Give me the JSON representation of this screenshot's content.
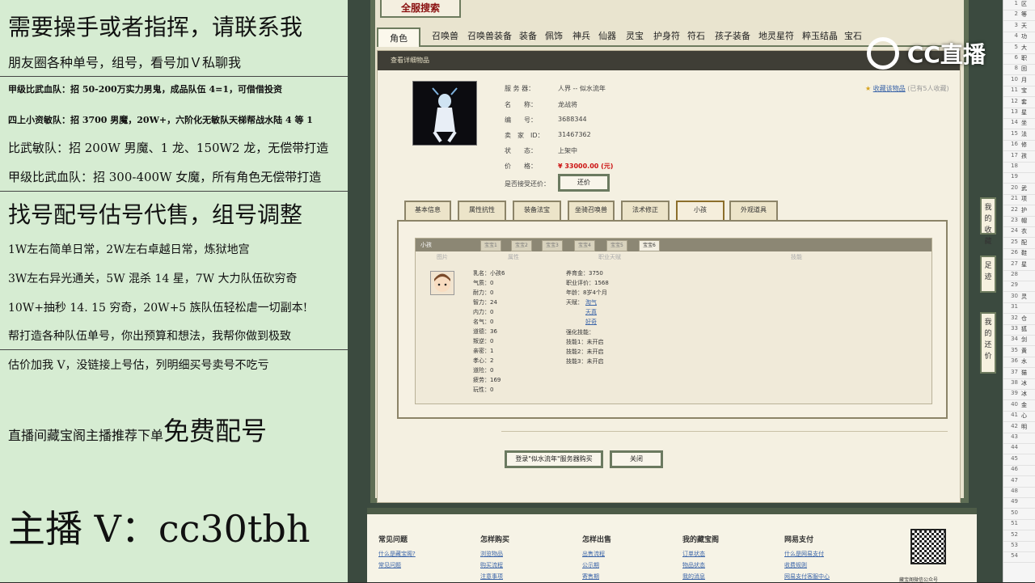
{
  "overlay": {
    "line1": "需要操手或者指挥，请联系我",
    "line2": "朋友圈各种单号，组号，看号加Ｖ私聊我",
    "line3": "甲级比武血队：招 50-200万实力男鬼，成品队伍 4=1，可借借投资",
    "line4": "四上小资敏队：招 3700 男魔，20W+，六阶化无敏队天梯帮战水陆 4 等 1",
    "line5": "比武敏队：招 200W 男魔、1 龙、150W2 龙，无偿带打造",
    "line6": "甲级比武血队：招 300-400W 女魔，所有角色无偿带打造",
    "line7": "找号配号估号代售，组号调整",
    "line8": "1W左右简单日常，2W左右卓越日常，炼狱地宫",
    "line9": "3W左右异光通关，5W 混杀 14 星，7W 大力队伍砍穷奇",
    "line10": "10W+抽秒 14. 15 穷奇，20W+5 族队伍轻松虐一切副本!",
    "line11": "帮打造各种队伍单号，你出预算和想法，我帮你做到极致",
    "line12": "估价加我 V，没链接上号估，列明细买号卖号不吃亏",
    "line13a": "直播间藏宝阁主播推荐下单",
    "line13b": "免费配号",
    "line14": "主播 V：cc30tbh"
  },
  "watermark": "CC直播",
  "search_tab": "全服搜索",
  "nav_tabs": [
    "角色",
    "召唤兽",
    "召唤兽装备",
    "装备",
    "佩饰",
    "神兵",
    "仙器",
    "灵宝",
    "护身符",
    "符石",
    "孩子装备",
    "地灵星符",
    "粹玉结晶",
    "宝石"
  ],
  "panel_title": "查看详细物品",
  "item": {
    "server_label": "服 务 器：",
    "server_value": "人界 -- 似水流年",
    "name_label": "名　　称：",
    "name_value": "龙战将",
    "id_label": "编　　号：",
    "id_value": "3688344",
    "seller_label": "卖　家　ID：",
    "seller_value": "31467362",
    "status_label": "状　　态：",
    "status_value": "上架中",
    "price_label": "价　　格：",
    "price_value": "¥ 33000.00 (元)",
    "bargain_label": "是否接受还价：",
    "bargain_button": "还价",
    "fav_link": "收藏该物品",
    "fav_count": "(已有5人收藏)"
  },
  "detail_tabs": [
    "基本信息",
    "属性抗性",
    "装备法宝",
    "坐骑召唤兽",
    "法术修正",
    "小孩",
    "外观道具"
  ],
  "child": {
    "header": "小孩",
    "babies": [
      "宝宝1",
      "宝宝2",
      "宝宝3",
      "宝宝4",
      "宝宝5",
      "宝宝6"
    ],
    "col_image": "图片",
    "col_attr": "属性",
    "col_career": "职业天赋",
    "col_skill": "技能",
    "stats": [
      "乳名：小孩6",
      "气质：0",
      "耐力：0",
      "智力：24",
      "内力：0",
      "名气：0",
      "道德：36",
      "叛逆：0",
      "亲密：1",
      "孝心：2",
      "道险：0",
      "疲劳：169",
      "玩性：0"
    ],
    "career": [
      "养育金：3750",
      "职业评价：1568",
      "年龄：8岁4个月",
      "天赋："
    ],
    "talents": [
      "淘气",
      "天真",
      "好奇"
    ],
    "skills_label": "强化技能：",
    "skills": [
      "技能1：未开启",
      "技能2：未开启",
      "技能3：未开启"
    ]
  },
  "buy_button": "登录\"似水流年\"服务器购买",
  "close_button": "关闭",
  "side_buttons": [
    "我的收藏",
    "足迹",
    "我的还价"
  ],
  "footer": {
    "cols": [
      {
        "title": "常见问题",
        "links": [
          "什么是藏宝阁?",
          "常见问题"
        ]
      },
      {
        "title": "怎样购买",
        "links": [
          "浏览物品",
          "购买流程",
          "注意事项"
        ]
      },
      {
        "title": "怎样出售",
        "links": [
          "出售流程",
          "公示期",
          "寄售期"
        ]
      },
      {
        "title": "我的藏宝阁",
        "links": [
          "订单状态",
          "物品状态",
          "我的消息"
        ]
      },
      {
        "title": "网易支付",
        "links": [
          "什么是网易支付",
          "收费规则",
          "网易支付客服中心"
        ]
      }
    ],
    "qr_caption": "藏宝阁微信公众号"
  },
  "sheet_rows": [
    {
      "n": "1",
      "t": "区"
    },
    {
      "n": "2",
      "t": "等"
    },
    {
      "n": "3",
      "t": "天"
    },
    {
      "n": "4",
      "t": "功"
    },
    {
      "n": "5",
      "t": "大"
    },
    {
      "n": "6",
      "t": "职"
    },
    {
      "n": "8",
      "t": "回"
    },
    {
      "n": "10",
      "t": "月"
    },
    {
      "n": "11",
      "t": "宝"
    },
    {
      "n": "12",
      "t": "套"
    },
    {
      "n": "13",
      "t": "星"
    },
    {
      "n": "14",
      "t": "坐"
    },
    {
      "n": "15",
      "t": "法"
    },
    {
      "n": "16",
      "t": "修"
    },
    {
      "n": "17",
      "t": "孩"
    },
    {
      "n": "18",
      "t": ""
    },
    {
      "n": "19",
      "t": ""
    },
    {
      "n": "20",
      "t": "武"
    },
    {
      "n": "21",
      "t": "项"
    },
    {
      "n": "22",
      "t": "护"
    },
    {
      "n": "23",
      "t": "帽"
    },
    {
      "n": "24",
      "t": "衣"
    },
    {
      "n": "25",
      "t": "配"
    },
    {
      "n": "26",
      "t": "鞋"
    },
    {
      "n": "27",
      "t": "星"
    },
    {
      "n": "28",
      "t": ""
    },
    {
      "n": "29",
      "t": ""
    },
    {
      "n": "30",
      "t": "灵"
    },
    {
      "n": "31",
      "t": ""
    },
    {
      "n": "32",
      "t": "仓"
    },
    {
      "n": "33",
      "t": "狐"
    },
    {
      "n": "34",
      "t": "剑"
    },
    {
      "n": "35",
      "t": "黄"
    },
    {
      "n": "36",
      "t": "水"
    },
    {
      "n": "37",
      "t": "猫"
    },
    {
      "n": "38",
      "t": "冰"
    },
    {
      "n": "39",
      "t": "冰"
    },
    {
      "n": "40",
      "t": "金"
    },
    {
      "n": "41",
      "t": "心"
    },
    {
      "n": "42",
      "t": "明"
    },
    {
      "n": "43",
      "t": ""
    },
    {
      "n": "44",
      "t": ""
    },
    {
      "n": "45",
      "t": ""
    },
    {
      "n": "46",
      "t": ""
    },
    {
      "n": "47",
      "t": ""
    },
    {
      "n": "48",
      "t": ""
    },
    {
      "n": "49",
      "t": ""
    },
    {
      "n": "50",
      "t": ""
    },
    {
      "n": "51",
      "t": ""
    },
    {
      "n": "52",
      "t": ""
    },
    {
      "n": "53",
      "t": ""
    },
    {
      "n": "54",
      "t": ""
    }
  ]
}
